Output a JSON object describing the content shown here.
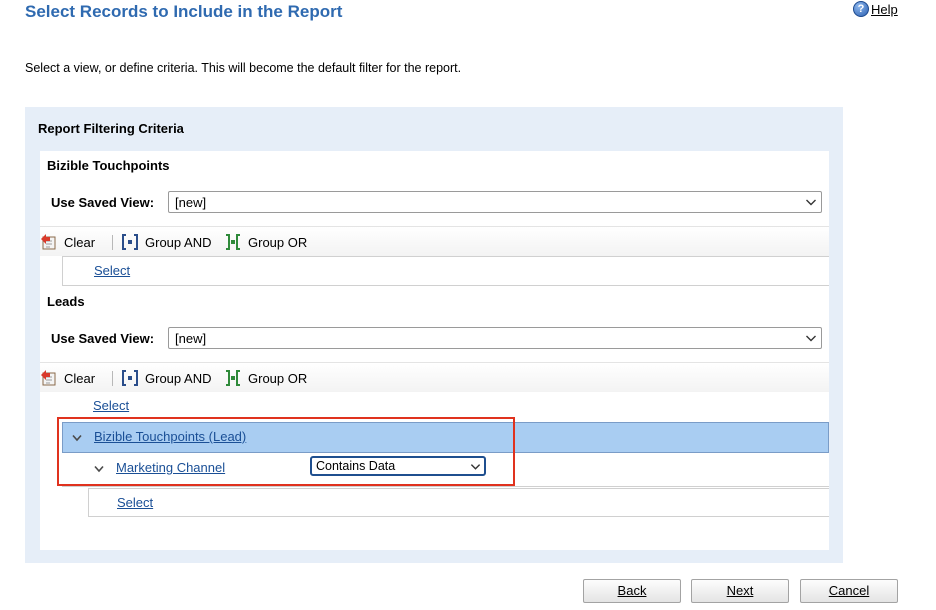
{
  "header": {
    "title": "Select Records to Include in the Report",
    "help_label": "Help",
    "instruction": "Select a view, or define criteria. This will become the default filter for the report."
  },
  "panel": {
    "title": "Report Filtering Criteria",
    "sections": [
      {
        "entity": "Bizible Touchpoints",
        "saved_view_label": "Use Saved View:",
        "saved_view_value": "[new]",
        "toolbar": {
          "clear": "Clear",
          "group_and": "Group AND",
          "group_or": "Group OR"
        },
        "select_link": "Select"
      },
      {
        "entity": "Leads",
        "saved_view_label": "Use Saved View:",
        "saved_view_value": "[new]",
        "toolbar": {
          "clear": "Clear",
          "group_and": "Group AND",
          "group_or": "Group OR"
        },
        "select_link": "Select",
        "related_group": {
          "label": "Bizible Touchpoints (Lead)",
          "condition": {
            "field": "Marketing Channel",
            "operator": "Contains Data"
          },
          "select_link": "Select"
        }
      }
    ]
  },
  "footer": {
    "back_label": "Back",
    "next_label": "Next",
    "cancel_label": "Cancel"
  },
  "colors": {
    "title_blue": "#2f6ab0",
    "panel_bg": "#e6eef8",
    "group_row_bg": "#a9cdf2",
    "highlight_red": "#e0321e"
  }
}
